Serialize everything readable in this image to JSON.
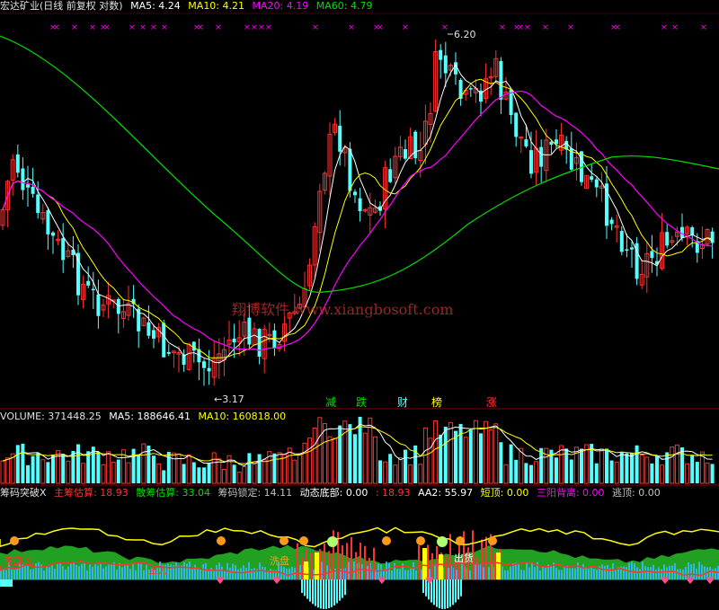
{
  "header": {
    "title": "宏达矿业(日线 前复权 对数)",
    "ma5": "MA5: 4.24",
    "ma10": "MA10: 4.21",
    "ma20": "MA20: 4.19",
    "ma60": "MA60: 4.79"
  },
  "watermark": "翔博软件 www.xiangbosoft.com",
  "price_labels": {
    "high": "6.20",
    "low": "3.17"
  },
  "signal_tags": [
    "减",
    "跌",
    "财",
    "榜",
    "涨"
  ],
  "volume_header": {
    "volume": "VOLUME: 371448.25",
    "ma5": "MA5: 188646.41",
    "ma10": "MA10: 160818.00"
  },
  "indicator_header": {
    "name": "筹码突破X",
    "main": "主筹估算: 18.93",
    "retail": "散筹估算: 33.04",
    "lock": "筹码锁定: 14.11",
    "bottom": "动态底部: 0.00",
    "v1": ": 18.93",
    "aa2": "AA2: 55.97",
    "top": "短顶: 0.00",
    "three": "三阳背离: 0.00",
    "escape": "逃顶: 0.00"
  },
  "indicator_labels": {
    "left": "底部区",
    "mid1": "洗盘",
    "mid2": "主力",
    "mid3": "出货"
  },
  "colors": {
    "up": "#ff3232",
    "down": "#54ffff",
    "ma5": "#ffffff",
    "ma10": "#ffff00",
    "ma20": "#ff00ff",
    "ma60": "#00e000",
    "grid": "#800000"
  },
  "chart_data": [
    {
      "type": "candlestick",
      "title": "宏达矿业(日线 前复权 对数)",
      "price_range": [
        3.0,
        6.4
      ],
      "log_scale": true,
      "high": 6.2,
      "low": 3.17,
      "series_labels": [
        "MA5",
        "MA10",
        "MA20",
        "MA60"
      ],
      "last_values": {
        "MA5": 4.24,
        "MA10": 4.21,
        "MA20": 4.19,
        "MA60": 4.79
      }
    },
    {
      "type": "bar",
      "title": "VOLUME",
      "last_values": {
        "VOLUME": 371448.25,
        "MA5": 188646.41,
        "MA10": 160818.0
      }
    }
  ]
}
